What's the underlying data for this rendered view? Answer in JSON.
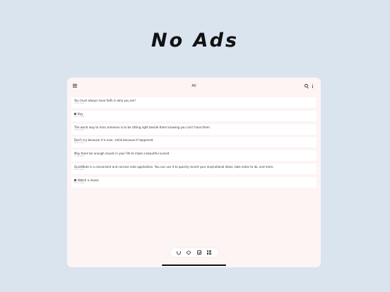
{
  "headline": "No  Ads",
  "app": {
    "title": "All",
    "icons": {
      "menu": "hamburger-menu-icon",
      "search": "search-icon",
      "more": "more-vertical-icon"
    }
  },
  "notes": [
    {
      "text": "You must always have faith in who you are!",
      "date": "10:02 2024",
      "checkbox": false
    },
    {
      "text": "Buy",
      "date": "10:02 2024",
      "checkbox": true
    },
    {
      "text": "The worst way to miss someone is to be sitting right beside them knowing you can't have them.",
      "date": "10:02 2024",
      "checkbox": false
    },
    {
      "text": "Don't cry because it is over, smile because it happened.",
      "date": "10:02 2024",
      "checkbox": false
    },
    {
      "text": "May there be enough clouds in your life to make a beautiful sunset.",
      "date": "10:02 2024",
      "checkbox": false
    },
    {
      "text": "QuickNote is a convenient and concise note application. You can use it to quickly record your inspirational ideas, take notes to do, and more.",
      "date": "10:02 2024",
      "checkbox": false
    },
    {
      "text": "Watch a movie",
      "date": "10:02 2024",
      "checkbox": true
    }
  ],
  "bottom_bar": [
    "refresh-icon",
    "tag-icon",
    "checklist-icon",
    "grid-icon"
  ],
  "colors": {
    "background": "#d9e4ef",
    "panel": "#fdf4f4",
    "card": "#ffffff",
    "text": "#333333"
  }
}
